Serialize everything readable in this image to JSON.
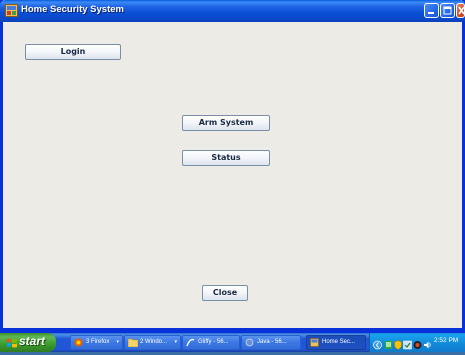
{
  "window": {
    "title": "Home Security System"
  },
  "buttons": {
    "login": "Login",
    "arm_system": "Arm System",
    "status": "Status",
    "close": "Close"
  },
  "taskbar": {
    "start_label": "start",
    "tasks": [
      {
        "label": "3 Firefox",
        "icon": "firefox-icon",
        "active": false
      },
      {
        "label": "2 Windo...",
        "icon": "folder-icon",
        "active": false
      },
      {
        "label": "Gliffy - 56...",
        "icon": "gliffy-icon",
        "active": false
      },
      {
        "label": "Java - 56...",
        "icon": "java-icon",
        "active": false
      },
      {
        "label": "Home Sec...",
        "icon": "app-window-icon",
        "active": true
      }
    ],
    "tray_icons": [
      "network-icon",
      "shield-icon",
      "security-icon",
      "speaker-icon",
      "settings-icon",
      "volume-icon"
    ],
    "clock": "2:52 PM"
  },
  "colors": {
    "titlebar": "#0a4fd4",
    "window_bg": "#ecebe6",
    "taskbar": "#2157d7",
    "start_green": "#3a9a2c",
    "tray": "#1289d8"
  }
}
